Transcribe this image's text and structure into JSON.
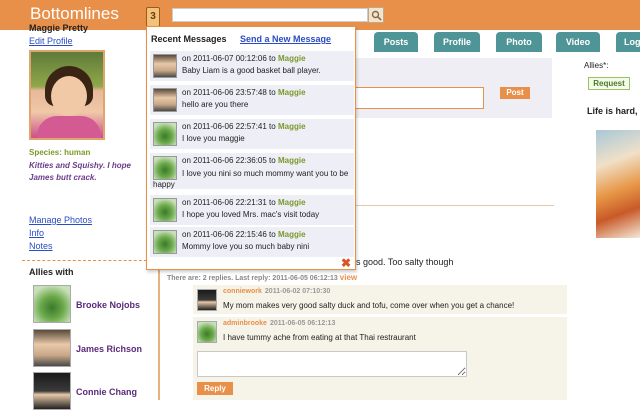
{
  "app": {
    "logo": "Bottomlines",
    "notification_count": "3"
  },
  "search": {
    "placeholder": ""
  },
  "tabs": [
    {
      "label": "Posts"
    },
    {
      "label": "Profile"
    },
    {
      "label": "Photo"
    },
    {
      "label": "Video"
    },
    {
      "label": "Log"
    }
  ],
  "profile": {
    "name": "Maggie Pretty",
    "edit_link": "Edit Profile",
    "species": "Species: human",
    "bio": "Kitties and Squishy. I hope James butt crack.",
    "links": [
      "Manage Photos",
      "Info",
      "Notes"
    ]
  },
  "allies": {
    "title": "Allies with",
    "items": [
      {
        "name": "Brooke Nojobs",
        "icon": "plant-avatar"
      },
      {
        "name": "James Richson",
        "icon": "boy-avatar"
      },
      {
        "name": "Connie Chang",
        "icon": "dark-avatar"
      }
    ]
  },
  "composer": {
    "post_button": "Post"
  },
  "feed": {
    "status_tail": "s good. Too salty though",
    "replies_meta": "There are: 2 replies. Last reply: 2011-06-05 06:12:13",
    "view_link": "view",
    "replies": [
      {
        "user": "conniework",
        "timestamp": "2011-06-02 07:10:30",
        "text": "My mom makes very good salty duck and tofu, come over when you get a chance!",
        "icon": "dark-avatar"
      },
      {
        "user": "adminbrooke",
        "timestamp": "2011-06-05 06:12:13",
        "text": "I have tummy ache from eating at that Thai restraurant",
        "icon": "plant-avatar"
      }
    ],
    "reply_button": "Reply"
  },
  "right": {
    "allies_label": "Allies*:",
    "request_button": "Request",
    "headline": "Life is hard, h"
  },
  "messages_popup": {
    "title": "Recent Messages",
    "send_link": "Send a New Message",
    "messages": [
      {
        "meta_prefix": "on 2011-06-07 00:12:06 to",
        "recipient": "Maggie",
        "text": "Baby Liam is a good basket ball player.",
        "icon": "boy-avatar"
      },
      {
        "meta_prefix": "on 2011-06-06 23:57:48 to",
        "recipient": "Maggie",
        "text": "hello are you there",
        "icon": "boy-avatar"
      },
      {
        "meta_prefix": "on 2011-06-06 22:57:41 to",
        "recipient": "Maggie",
        "text": "I love you maggie",
        "icon": "plant-avatar"
      },
      {
        "meta_prefix": "on 2011-06-06 22:36:05 to",
        "recipient": "Maggie",
        "text": "I love you nini so much mommy want you to be happy",
        "icon": "plant-avatar"
      },
      {
        "meta_prefix": "on 2011-06-06 22:21:31 to",
        "recipient": "Maggie",
        "text": "I hope you loved Mrs. mac's visit today",
        "icon": "plant-avatar"
      },
      {
        "meta_prefix": "on 2011-06-06 22:15:46 to",
        "recipient": "Maggie",
        "text": "Mommy love you so much baby nini",
        "icon": "plant-avatar"
      }
    ],
    "close_icon": "close-icon"
  },
  "colors": {
    "brand": "#e8904a",
    "tab": "#4f9597",
    "link": "#2a4cc4",
    "ally_name": "#5a2a7a",
    "species": "#7a9a2a"
  }
}
